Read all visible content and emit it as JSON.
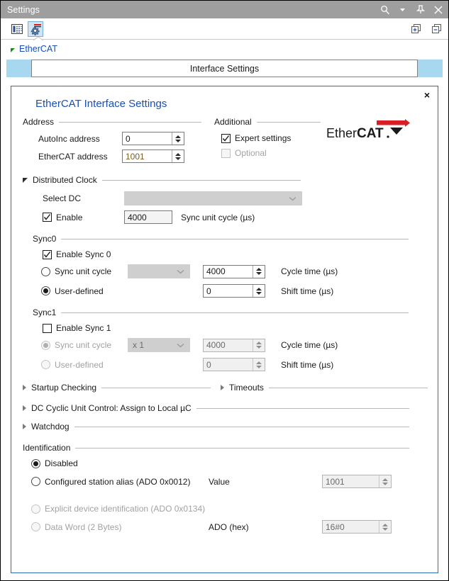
{
  "window": {
    "title": "Settings",
    "titlebar_icons": [
      "search-icon",
      "dropdown-arrow-icon",
      "pin-icon",
      "close-icon"
    ],
    "accent_blue": "#2b6cb5",
    "title_bar_color": "#9e9e9e",
    "tab_edge_color": "#a8d8ef"
  },
  "toolbar": {
    "icons": [
      {
        "name": "grid-matrix-icon",
        "selected": false
      },
      {
        "name": "gear-config-icon",
        "selected": true
      }
    ],
    "right_icons": [
      {
        "name": "expand-all-icon"
      },
      {
        "name": "collapse-all-icon"
      }
    ]
  },
  "tree": {
    "root_label": "EtherCAT",
    "expanded": true
  },
  "tab": {
    "label": "Interface Settings"
  },
  "panel": {
    "title": "EtherCAT Interface Settings",
    "close_label": "×",
    "logo_text_light": "Ether",
    "logo_text_bold": "CAT",
    "logo_dot": "."
  },
  "address": {
    "group_label": "Address",
    "auto_inc": {
      "label": "AutoInc address",
      "value": "0"
    },
    "ethercat": {
      "label": "EtherCAT address",
      "value": "1001"
    }
  },
  "additional": {
    "group_label": "Additional",
    "expert_settings": {
      "label": "Expert settings",
      "checked": true,
      "enabled": true
    },
    "optional": {
      "label": "Optional",
      "checked": false,
      "enabled": false
    }
  },
  "distributed_clock": {
    "group_label": "Distributed Clock",
    "expanded": true,
    "select_dc": {
      "label": "Select DC",
      "value": "",
      "enabled": false
    },
    "enable": {
      "label": "Enable",
      "checked": true
    },
    "sync_unit_cycle": {
      "value": "4000",
      "unit_label": "Sync unit cycle (µs)"
    }
  },
  "sync0": {
    "group_label": "Sync0",
    "enable": {
      "label": "Enable Sync 0",
      "checked": true
    },
    "mode_sync_unit_cycle": {
      "label": "Sync unit cycle",
      "selected": false
    },
    "mode_user_defined": {
      "label": "User-defined",
      "selected": true
    },
    "multiplier": {
      "value": "",
      "enabled": false
    },
    "cycle_time": {
      "value": "4000",
      "label": "Cycle time (µs)"
    },
    "shift_time": {
      "value": "0",
      "label": "Shift time (µs)"
    }
  },
  "sync1": {
    "group_label": "Sync1",
    "enable": {
      "label": "Enable Sync 1",
      "checked": false
    },
    "mode_sync_unit_cycle": {
      "label": "Sync unit cycle",
      "selected": true,
      "enabled": false
    },
    "mode_user_defined": {
      "label": "User-defined",
      "selected": false,
      "enabled": false
    },
    "multiplier": {
      "value": "x 1",
      "enabled": false
    },
    "cycle_time": {
      "value": "4000",
      "label": "Cycle time (µs)"
    },
    "shift_time": {
      "value": "0",
      "label": "Shift time (µs)"
    }
  },
  "collapsed_sections": {
    "startup_checking": "Startup Checking",
    "timeouts": "Timeouts",
    "dc_cyclic": "DC Cyclic Unit Control: Assign to Local µC",
    "watchdog": "Watchdog"
  },
  "identification": {
    "group_label": "Identification",
    "disabled": {
      "label": "Disabled",
      "selected": true,
      "enabled": true
    },
    "station_alias": {
      "label": "Configured station alias (ADO 0x0012)",
      "selected": false,
      "enabled": true
    },
    "value_label": "Value",
    "value": "1001",
    "explicit": {
      "label": "Explicit device identification (ADO 0x0134)",
      "selected": false,
      "enabled": false
    },
    "data_word": {
      "label": "Data Word (2 Bytes)",
      "selected": false,
      "enabled": false
    },
    "ado_label": "ADO (hex)",
    "ado_value": "16#0"
  }
}
